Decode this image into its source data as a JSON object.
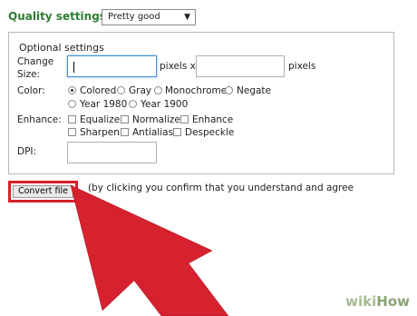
{
  "quality": {
    "label": "Quality settings:",
    "selected_value": "Pretty good"
  },
  "optional": {
    "heading": "Optional settings",
    "change_size_label_line1": "Change",
    "change_size_label_line2": "Size:",
    "pixels_x_label": "pixels x",
    "pixels_label": "pixels",
    "width_value": "",
    "height_value": "",
    "color_label": "Color:",
    "color_options": [
      "Colored",
      "Gray",
      "Monochrome",
      "Negate",
      "Year 1980",
      "Year 1900"
    ],
    "color_selected": "Colored",
    "enhance_label": "Enhance:",
    "enhance_options": [
      "Equalize",
      "Normalize",
      "Enhance",
      "Sharpen",
      "Antialias",
      "Despeckle"
    ],
    "dpi_label": "DPI:",
    "dpi_value": ""
  },
  "actions": {
    "convert_label": "Convert file",
    "confirm_text": "(by clicking you confirm that you understand and agree"
  },
  "colors": {
    "heading_green": "#2e7d32",
    "highlight_red": "#d71f2b",
    "arrow_red": "#d6212e"
  },
  "watermark": {
    "wiki": "wiki",
    "how": "How"
  }
}
